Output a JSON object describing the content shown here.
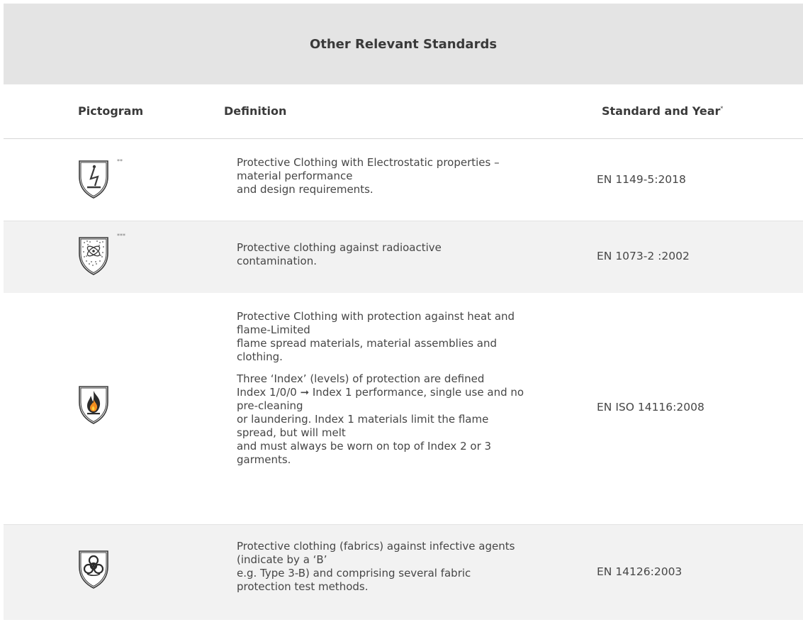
{
  "section_title": "Other Relevant Standards",
  "columns": {
    "pictogram": "Pictogram",
    "definition": "Definition",
    "standard": "Standard and Year",
    "standard_mark": "*"
  },
  "rows": [
    {
      "icon": "electrostatic-icon",
      "stars": "**",
      "definition_lines": [
        "Protective Clothing with Electrostatic properties –",
        "material performance",
        "and design requirements."
      ],
      "standard": "EN 1149-5:2018"
    },
    {
      "icon": "radioactive-contamination-icon",
      "stars": "***",
      "definition_lines": [
        "Protective clothing against radioactive",
        "contamination."
      ],
      "standard": "EN 1073-2 :2002"
    },
    {
      "icon": "flame-icon",
      "stars": "",
      "definition_lines": [
        "Protective Clothing with protection against heat and",
        "flame-Limited",
        "flame spread materials, material assemblies and",
        "clothing."
      ],
      "definition_lines_2": [
        "Three ‘Index’ (levels) of protection are defined",
        "Index 1/0/0 ➞ Index 1 performance, single use and no",
        "pre-cleaning",
        "or laundering. Index 1 materials limit the flame",
        "spread, but will melt",
        "and must always be worn on top of Index 2 or 3",
        "garments."
      ],
      "standard": "EN ISO 14116:2008"
    },
    {
      "icon": "biohazard-icon",
      "stars": "",
      "definition_lines": [
        "Protective clothing (fabrics) against infective agents",
        "(indicate by a ‘B’",
        "e.g. Type 3-B) and comprising several fabric",
        "protection test methods."
      ],
      "standard": "EN 14126:2003"
    }
  ]
}
